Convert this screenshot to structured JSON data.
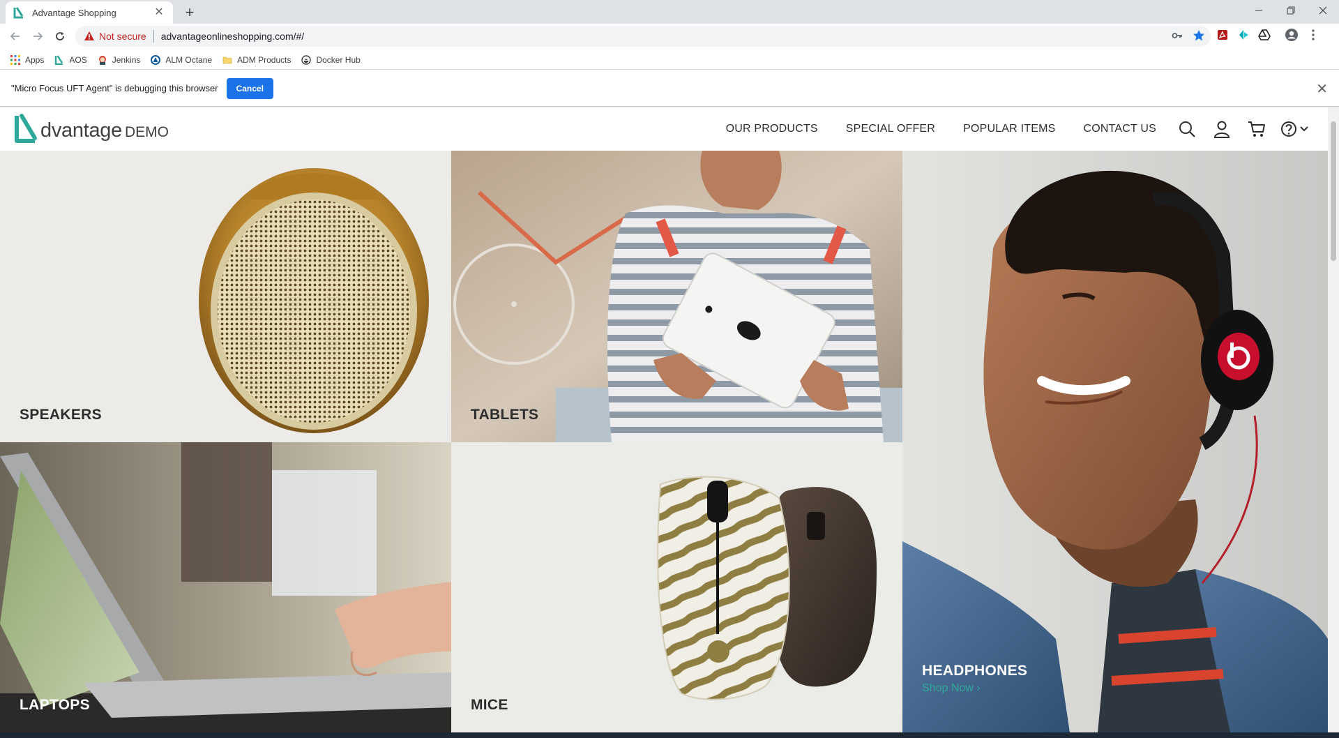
{
  "browser": {
    "tab_title": "Advantage Shopping",
    "tab_close": "✕",
    "new_tab": "+",
    "not_secure": "Not secure",
    "url": "advantageonlineshopping.com/#/",
    "bookmarks": [
      "Apps",
      "AOS",
      "Jenkins",
      "ALM Octane",
      "ADM Products",
      "Docker Hub"
    ]
  },
  "infobar": {
    "message": "\"Micro Focus UFT Agent\" is debugging this browser",
    "cancel_label": "Cancel",
    "close": "✕"
  },
  "site": {
    "logo_word": "dvantage",
    "logo_demo": "DEMO",
    "menu": [
      "OUR PRODUCTS",
      "SPECIAL OFFER",
      "POPULAR ITEMS",
      "CONTACT US"
    ],
    "accent_color": "#2fa89c"
  },
  "categories": [
    {
      "label": "SPEAKERS"
    },
    {
      "label": "TABLETS"
    },
    {
      "label": "HEADPHONES",
      "cta": "Shop Now ›"
    },
    {
      "label": "LAPTOPS"
    },
    {
      "label": "MICE"
    }
  ]
}
